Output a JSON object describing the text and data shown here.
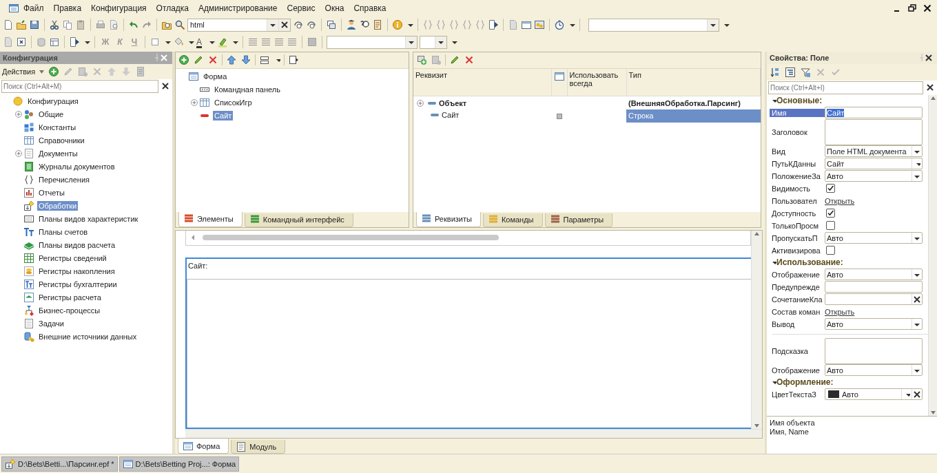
{
  "menu": [
    "Файл",
    "Правка",
    "Конфигурация",
    "Отладка",
    "Администрирование",
    "Сервис",
    "Окна",
    "Справка"
  ],
  "toolbar": {
    "search_value": "html",
    "format_buttons": [
      "Ж",
      "К",
      "Ч"
    ],
    "font_color_glyph": "A"
  },
  "config_panel": {
    "title": "Конфигурация",
    "actions_label": "Действия",
    "search_placeholder": "Поиск (Ctrl+Alt+M)",
    "tree": [
      {
        "label": "Конфигурация",
        "collapsed": false,
        "selected": false,
        "children": [
          {
            "label": "Общие",
            "collapsed": true,
            "selected": false
          },
          {
            "label": "Константы",
            "collapsed": false,
            "selected": false
          },
          {
            "label": "Справочники",
            "collapsed": false,
            "selected": false
          },
          {
            "label": "Документы",
            "collapsed": true,
            "selected": false
          },
          {
            "label": "Журналы документов",
            "collapsed": false,
            "selected": false
          },
          {
            "label": "Перечисления",
            "collapsed": false,
            "selected": false
          },
          {
            "label": "Отчеты",
            "collapsed": false,
            "selected": false
          },
          {
            "label": "Обработки",
            "collapsed": false,
            "selected": true
          },
          {
            "label": "Планы видов характеристик",
            "collapsed": false,
            "selected": false
          },
          {
            "label": "Планы счетов",
            "collapsed": false,
            "selected": false
          },
          {
            "label": "Планы видов расчета",
            "collapsed": false,
            "selected": false
          },
          {
            "label": "Регистры сведений",
            "collapsed": false,
            "selected": false
          },
          {
            "label": "Регистры накопления",
            "collapsed": false,
            "selected": false
          },
          {
            "label": "Регистры бухгалтерии",
            "collapsed": false,
            "selected": false
          },
          {
            "label": "Регистры расчета",
            "collapsed": false,
            "selected": false
          },
          {
            "label": "Бизнес-процессы",
            "collapsed": false,
            "selected": false
          },
          {
            "label": "Задачи",
            "collapsed": false,
            "selected": false
          },
          {
            "label": "Внешние источники данных",
            "collapsed": false,
            "selected": false
          }
        ]
      }
    ]
  },
  "elements": {
    "tree": [
      {
        "label": "Форма",
        "collapsed": false,
        "selected": false,
        "children": [
          {
            "label": "Командная панель",
            "collapsed": false,
            "selected": false
          },
          {
            "label": "СписокИгр",
            "collapsed": true,
            "selected": false
          },
          {
            "label": "Сайт",
            "collapsed": false,
            "selected": true
          }
        ]
      }
    ],
    "tabs": [
      {
        "label": "Элементы",
        "selected": true
      },
      {
        "label": "Командный интерфейс",
        "selected": false
      }
    ]
  },
  "attributes": {
    "columns": [
      "Реквизит",
      "Использовать всегда",
      "Тип"
    ],
    "rows": [
      {
        "name": "Объект",
        "bold": true,
        "collapsed": true,
        "always": false,
        "type": "(ВнешняяОбработка.Парсинг)",
        "selected": false
      },
      {
        "name": "Сайт",
        "bold": false,
        "collapsed": false,
        "always": true,
        "type": "Строка",
        "selected": true
      }
    ],
    "tabs": [
      {
        "label": "Реквизиты",
        "selected": true
      },
      {
        "label": "Команды",
        "selected": false
      },
      {
        "label": "Параметры",
        "selected": false
      }
    ]
  },
  "form_preview": {
    "field_title": "Сайт:"
  },
  "form_tabs": [
    {
      "label": "Форма",
      "selected": true
    },
    {
      "label": "Модуль",
      "selected": false
    }
  ],
  "properties": {
    "title": "Свойства: Поле",
    "search_placeholder": "Поиск (Ctrl+Alt+I)",
    "rows": [
      {
        "kind": "group",
        "label": "Основные:"
      },
      {
        "kind": "text",
        "label": "Имя",
        "value": "Сайт",
        "selected": true
      },
      {
        "kind": "multiline",
        "label": "Заголовок",
        "selected": false
      },
      {
        "kind": "select",
        "label": "Вид",
        "value": "Поле HTML документа",
        "selected": false
      },
      {
        "kind": "choice",
        "label": "ПутьКДанны",
        "value": "Сайт",
        "selected": false
      },
      {
        "kind": "select",
        "label": "ПоложениеЗа",
        "value": "Авто",
        "selected": false
      },
      {
        "kind": "check",
        "label": "Видимость",
        "checked": true,
        "selected": false
      },
      {
        "kind": "link",
        "label": "Пользовател",
        "value": "Открыть",
        "selected": false
      },
      {
        "kind": "check",
        "label": "Доступность",
        "checked": true,
        "selected": false
      },
      {
        "kind": "check",
        "label": "ТолькоПросм",
        "checked": false,
        "selected": false
      },
      {
        "kind": "select",
        "label": "ПропускатьП",
        "value": "Авто",
        "selected": false
      },
      {
        "kind": "check",
        "label": "Активизирова",
        "checked": false,
        "selected": false
      },
      {
        "kind": "group",
        "label": "Использование:"
      },
      {
        "kind": "select",
        "label": "Отображение",
        "value": "Авто",
        "selected": false
      },
      {
        "kind": "text",
        "label": "Предупрежде",
        "selected": false
      },
      {
        "kind": "clear",
        "label": "СочетаниеКла",
        "selected": false
      },
      {
        "kind": "link",
        "label": "Состав коман",
        "value": "Открыть",
        "selected": false
      },
      {
        "kind": "select",
        "label": "Вывод",
        "value": "Авто",
        "selected": false
      },
      {
        "kind": "separator"
      },
      {
        "kind": "multiline",
        "label": "Подсказка",
        "selected": false
      },
      {
        "kind": "select",
        "label": "Отображение",
        "value": "Авто",
        "selected": false
      },
      {
        "kind": "group",
        "label": "Оформление:"
      },
      {
        "kind": "color",
        "label": "ЦветТекстаЗ",
        "value": "Авто",
        "color": "#2b2b2b",
        "selected": false
      }
    ],
    "description": [
      "Имя объекта",
      "Имя, Name"
    ]
  },
  "taskbar": [
    {
      "label": "D:\\Bets\\Betti...\\Парсинг.epf *",
      "selected": false
    },
    {
      "label": "D:\\Bets\\Betting Proj...: Форма",
      "selected": false
    }
  ]
}
